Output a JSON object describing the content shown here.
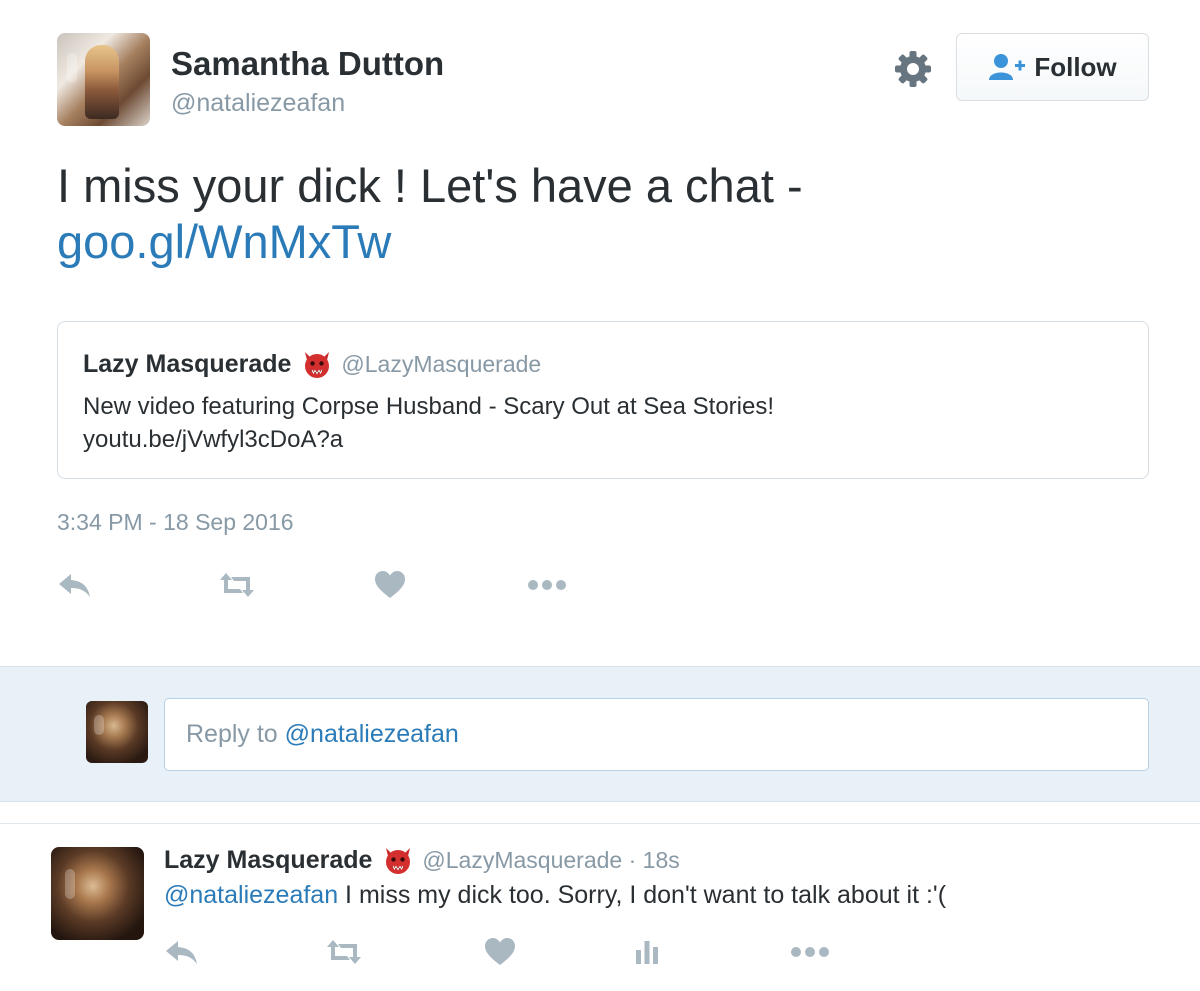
{
  "tweet": {
    "author_name": "Samantha Dutton",
    "author_handle": "@nataliezeafan",
    "follow_label": "Follow",
    "text_line1": "I miss your dick !  Let's have a chat -",
    "text_link": "goo.gl/WnMxTw",
    "timestamp": "3:34 PM - 18 Sep 2016",
    "quote": {
      "name": "Lazy Masquerade",
      "handle": "@LazyMasquerade",
      "text": "New video featuring Corpse Husband - Scary Out at Sea Stories!",
      "link": "youtu.be/jVwfyl3cDoA?a"
    },
    "actions": [
      "reply-icon",
      "retweet-icon",
      "like-icon",
      "more-icon"
    ]
  },
  "reply_box": {
    "prefix": "Reply to ",
    "mention": "@nataliezeafan"
  },
  "reply": {
    "name": "Lazy Masquerade",
    "handle_time": "@LazyMasquerade · 18s",
    "mention": "@nataliezeafan",
    "text": " I miss my dick too. Sorry, I don't want to talk about it :'(",
    "actions": [
      "reply-icon",
      "retweet-icon",
      "like-icon",
      "analytics-icon",
      "more-icon"
    ]
  },
  "colors": {
    "link": "#2b7bb9",
    "muted": "#8899a6",
    "text": "#292f33",
    "reply_area_bg": "#e9f1f8",
    "devil_red": "#d32f2f"
  }
}
